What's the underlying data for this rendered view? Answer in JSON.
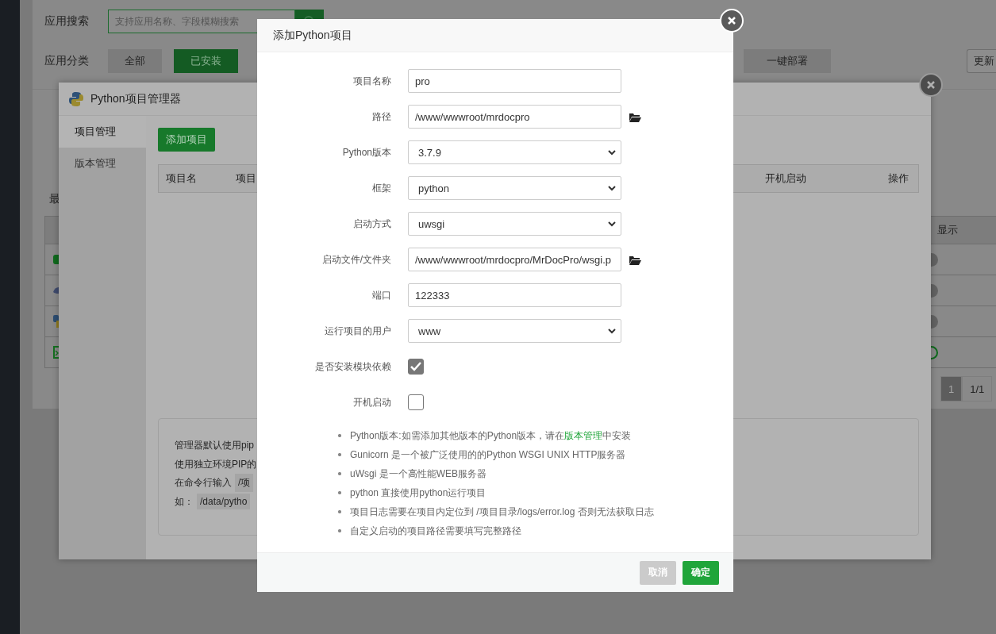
{
  "background_page": {
    "search": {
      "label": "应用搜索",
      "placeholder": "支持应用名称、字段模糊搜索"
    },
    "category_label": "应用分类",
    "categories": [
      {
        "label": "全部",
        "selected": false
      },
      {
        "label": "已安装",
        "selected": true
      }
    ],
    "deploy_button": "一键部署",
    "update_button": "更新",
    "section_fragment": "最",
    "column_fragment": "显示",
    "rows": [
      {
        "kind": "shield",
        "on": false
      },
      {
        "kind": "php",
        "on": false
      },
      {
        "kind": "python",
        "on": false
      },
      {
        "kind": "terminal",
        "on": true
      }
    ],
    "pagination": [
      {
        "label": "1",
        "selected": true
      },
      {
        "label": "1/1",
        "selected": false
      }
    ]
  },
  "manager": {
    "title": "Python项目管理器",
    "tabs": [
      {
        "label": "项目管理",
        "selected": true
      },
      {
        "label": "版本管理",
        "selected": false
      }
    ],
    "add_button": "添加项目",
    "columns": [
      "项目名",
      "项目",
      "开机启动",
      "操作"
    ],
    "info": [
      {
        "text": "管理器默认使用pip"
      },
      {
        "text": "使用独立环境PIP的"
      },
      {
        "text": "在命令行输入",
        "code": "/项"
      },
      {
        "text": "如：",
        "code": "/data/pytho"
      }
    ]
  },
  "dialog": {
    "title": "添加Python项目",
    "fields": [
      {
        "label": "项目名称",
        "kind": "text",
        "value": "pro"
      },
      {
        "label": "路径",
        "kind": "text",
        "value": "/www/wwwroot/mrdocpro",
        "browse": true
      },
      {
        "label": "Python版本",
        "kind": "select",
        "value": "3.7.9"
      },
      {
        "label": "框架",
        "kind": "select",
        "value": "python"
      },
      {
        "label": "启动方式",
        "kind": "select",
        "value": "uwsgi"
      },
      {
        "label": "启动文件/文件夹",
        "kind": "text",
        "value": "/www/wwwroot/mrdocpro/MrDocPro/wsgi.p",
        "browse": true
      },
      {
        "label": "端口",
        "kind": "text",
        "value": "122333"
      },
      {
        "label": "运行项目的用户",
        "kind": "select",
        "value": "www"
      },
      {
        "label": "是否安装模块依赖",
        "kind": "checkbox",
        "checked": true
      },
      {
        "label": "开机启动",
        "kind": "checkbox",
        "checked": false
      }
    ],
    "notes": [
      {
        "text": "Python版本:如需添加其他版本的Python版本，请在",
        "link": "版本管理",
        "after": "中安装"
      },
      {
        "text": "Gunicorn 是一个被广泛使用的的Python WSGI UNIX HTTP服务器"
      },
      {
        "text": "uWsgi 是一个高性能WEB服务器"
      },
      {
        "text": "python 直接使用python运行项目"
      },
      {
        "text": "项目日志需要在项目内定位到 /项目目录/logs/error.log 否则无法获取日志"
      },
      {
        "text": "自定义启动的项目路径需要填写完整路径"
      }
    ],
    "buttons": [
      {
        "label": "取消",
        "kind": "cancel"
      },
      {
        "label": "确定",
        "kind": "confirm"
      }
    ]
  }
}
